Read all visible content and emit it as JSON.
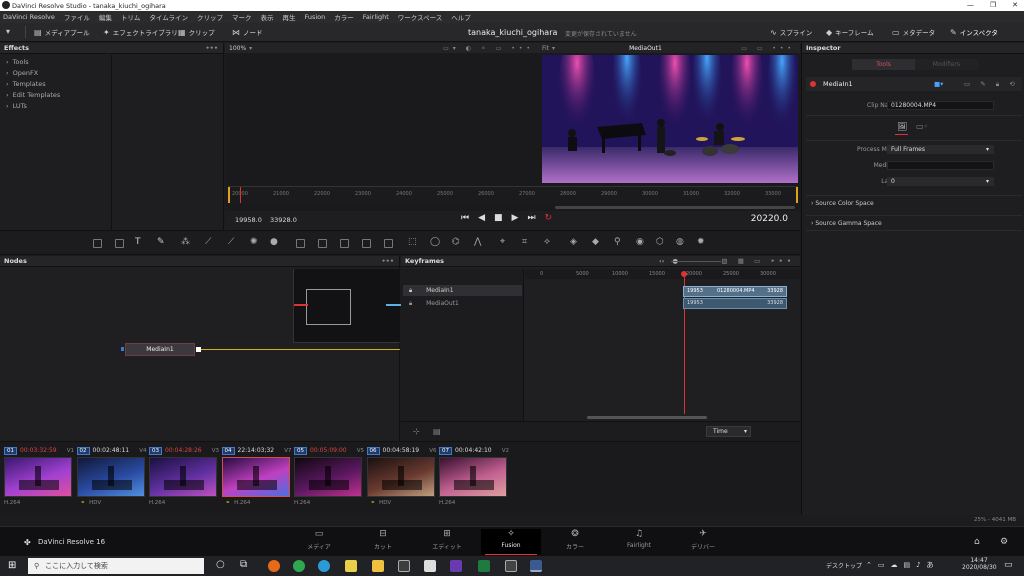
{
  "window": {
    "title": "DaVinci Resolve Studio - tanaka_kiuchi_ogihara",
    "controls": [
      "—",
      "❐",
      "✕"
    ]
  },
  "menu": [
    "DaVinci Resolve",
    "ファイル",
    "編集",
    "トリム",
    "タイムライン",
    "クリップ",
    "マーク",
    "表示",
    "再生",
    "Fusion",
    "カラー",
    "Fairlight",
    "ワークスペース",
    "ヘルプ"
  ],
  "toolbar": {
    "media_pool": "メディアプール",
    "effects_library": "エフェクトライブラリ",
    "clips": "クリップ",
    "nodes": "ノード",
    "project_title": "tanaka_kiuchi_ogihara",
    "unsaved": "変更が保存されていません",
    "spline": "スプライン",
    "keyframes": "キーフレーム",
    "metadata": "メタデータ",
    "inspector": "インスペクタ"
  },
  "effects": {
    "title": "Effects",
    "items": [
      "Tools",
      "OpenFX",
      "Templates",
      "Edit Templates",
      "LUTs"
    ]
  },
  "viewer": {
    "zoom": "100%",
    "output_name": "MediaOut1",
    "resolution_menu": "Fit"
  },
  "ruler_ticks": [
    "20000",
    "21000",
    "22000",
    "23000",
    "24000",
    "25000",
    "26000",
    "27000",
    "28000",
    "29000",
    "30000",
    "31000",
    "32000",
    "33000"
  ],
  "transport": {
    "start": "19958.0",
    "end": "33928.0",
    "current": "20220.0"
  },
  "nodes": {
    "title": "Nodes",
    "node_label": "MediaIn1"
  },
  "keyframes": {
    "title": "Keyframes",
    "tracks": [
      "MediaIn1",
      "MediaOut1"
    ],
    "ticks": [
      "0",
      "5000",
      "10000",
      "15000",
      "20000",
      "25000",
      "30000"
    ],
    "bar1": {
      "start": "19953",
      "name": "01280004.MP4",
      "end": "33928"
    },
    "bar2": {
      "start": "19953",
      "end": "33928"
    },
    "time_mode": "Time"
  },
  "inspector": {
    "title": "Inspector",
    "tab_tools": "Tools",
    "tab_modifiers": "Modifiers",
    "node_name": "MediaIn1",
    "clip_name_label": "Clip Name",
    "clip_name": "01280004.MP4",
    "process_mode_label": "Process Mode",
    "process_mode": "Full Frames",
    "mediaid_label": "MediaID",
    "mediaid": "",
    "layer_label": "Layer",
    "layer": "0",
    "section1": "Source Color Space",
    "section2": "Source Gamma Space"
  },
  "clips": [
    {
      "num": "01",
      "tc": "00:03:32:59",
      "red": true,
      "track": "V1",
      "codec": "H.264",
      "extra": ""
    },
    {
      "num": "02",
      "tc": "00:02:48:11",
      "red": false,
      "track": "V4",
      "codec": "",
      "extra": "HDV"
    },
    {
      "num": "03",
      "tc": "00:04:28:26",
      "red": true,
      "track": "V3",
      "codec": "H.264",
      "extra": ""
    },
    {
      "num": "04",
      "tc": "22:14:03;32",
      "red": false,
      "track": "V7",
      "codec": "",
      "extra": "H.264"
    },
    {
      "num": "05",
      "tc": "00:05:09:00",
      "red": true,
      "track": "V5",
      "codec": "H.264",
      "extra": ""
    },
    {
      "num": "06",
      "tc": "00:04:58:19",
      "red": false,
      "track": "V6",
      "codec": "",
      "extra": "HDV"
    },
    {
      "num": "07",
      "tc": "00:04:42:10",
      "red": false,
      "track": "V2",
      "codec": "H.264",
      "extra": ""
    }
  ],
  "status": {
    "memory": "25% - 4041 MB"
  },
  "app": {
    "name": "DaVinci Resolve 16"
  },
  "pages": [
    "メディア",
    "カット",
    "エディット",
    "Fusion",
    "カラー",
    "Fairlight",
    "デリバー"
  ],
  "taskbar": {
    "search_placeholder": "ここに入力して検索",
    "desktop": "デスクトップ",
    "time": "14:47",
    "date": "2020/08/30"
  }
}
